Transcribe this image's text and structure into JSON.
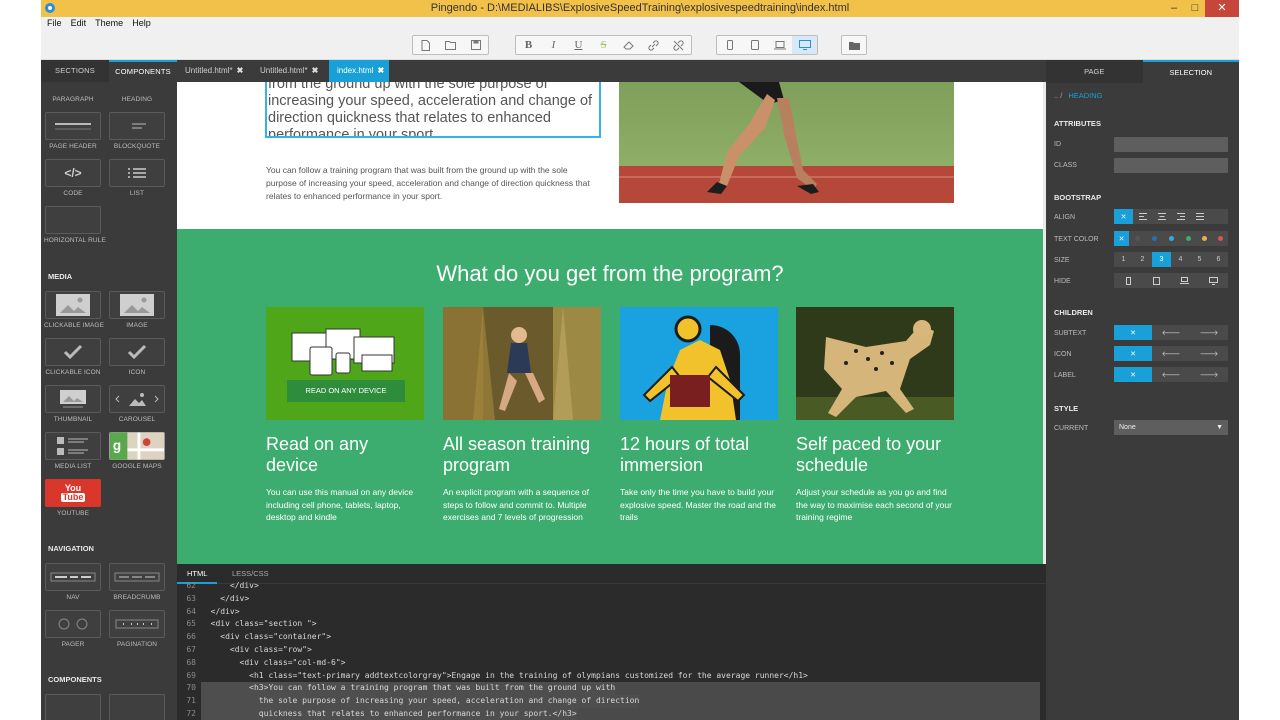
{
  "window": {
    "title": "Pingendo - D:\\MEDIALIBS\\ExplosiveSpeedTraining\\explosivespeedtraining\\index.html",
    "minimize": "–",
    "maximize": "□",
    "close": "✕"
  },
  "menu": [
    "File",
    "Edit",
    "Theme",
    "Help"
  ],
  "toolbar": {
    "file_icons": [
      "new-file-icon",
      "open-folder-icon",
      "save-icon"
    ],
    "format": {
      "bold": "B",
      "italic": "I",
      "underline": "U",
      "strike": "S"
    },
    "format_icons": [
      "eraser-icon",
      "link-icon",
      "unlink-icon"
    ],
    "devices": [
      "phone-icon",
      "tablet-icon",
      "laptop-icon",
      "desktop-icon"
    ],
    "active_device": "desktop-icon",
    "folder_icon": "folder-icon"
  },
  "left_panel": {
    "tabs": [
      "SECTIONS",
      "COMPONENTS"
    ],
    "active_tab": "COMPONENTS",
    "items_top": [
      {
        "label": "PARAGRAPH"
      },
      {
        "label": "HEADING"
      },
      {
        "label": "PAGE HEADER"
      },
      {
        "label": "BLOCKQUOTE"
      },
      {
        "label": "CODE"
      },
      {
        "label": "LIST"
      },
      {
        "label": "HORIZONTAL RULE"
      }
    ],
    "media_heading": "MEDIA",
    "media_items": [
      {
        "label": "CLICKABLE IMAGE"
      },
      {
        "label": "IMAGE"
      },
      {
        "label": "CLICKABLE ICON"
      },
      {
        "label": "ICON"
      },
      {
        "label": "THUMBNAIL"
      },
      {
        "label": "CAROUSEL"
      },
      {
        "label": "MEDIA LIST"
      },
      {
        "label": "GOOGLE MAPS"
      },
      {
        "label": "YOUTUBE",
        "thumb_text_1": "You",
        "thumb_text_2": "Tube"
      }
    ],
    "nav_heading": "NAVIGATION",
    "nav_items": [
      {
        "label": "NAV"
      },
      {
        "label": "BREADCRUMB"
      },
      {
        "label": "PAGER"
      },
      {
        "label": "PAGINATION"
      }
    ],
    "components_heading": "COMPONENTS",
    "code_glyph": "</>"
  },
  "doc_tabs": [
    {
      "label": "Untitled.html*",
      "close": "✖"
    },
    {
      "label": "Untitled.html*",
      "close": "✖"
    },
    {
      "label": "index.html",
      "close": "✖"
    }
  ],
  "active_doc": "index.html",
  "canvas": {
    "hero_heading": "from the ground up with the sole purpose of increasing your speed, acceleration and change of direction quickness that relates to enhanced performance in your sport.",
    "hero_paragraph": "You can follow a training program that was built from the ground up with the sole purpose of increasing your speed, acceleration and change of direction quickness that relates to enhanced performance in your sport.",
    "section_title": "What do you get from the program?",
    "accent_green": "#3dad6f",
    "features": [
      {
        "title": "Read on any device",
        "text": "You can use this manual on any device including cell phone, tablets, laptop, desktop and kindle",
        "button": "READ ON ANY DEVICE"
      },
      {
        "title": "All season training program",
        "text": "An explicit program with a sequence of steps to follow and commit to. Multiple exercises and 7 levels of progression"
      },
      {
        "title": "12 hours of total immersion",
        "text": "Take only the time you have to build your explosive speed. Master the road and the trails"
      },
      {
        "title": "Self paced to your schedule",
        "text": "Adjust your schedule as you go and find the way to maximise each second of your training regime"
      }
    ]
  },
  "code": {
    "tabs": [
      "HTML",
      "LESS/CSS"
    ],
    "active_tab": "HTML",
    "lines": [
      {
        "n": "62",
        "indent": "      ",
        "html": "</div>"
      },
      {
        "n": "63",
        "indent": "    ",
        "html": "</div>"
      },
      {
        "n": "64",
        "indent": "  ",
        "html": "</div>"
      },
      {
        "n": "65",
        "indent": "  ",
        "html": "<div class=\"section \">"
      },
      {
        "n": "66",
        "indent": "    ",
        "html": "<div class=\"container\">"
      },
      {
        "n": "67",
        "indent": "      ",
        "html": "<div class=\"row\">"
      },
      {
        "n": "68",
        "indent": "        ",
        "html": "<div class=\"col-md-6\">"
      },
      {
        "n": "69",
        "indent": "          ",
        "html": "<h1 class=\"text-primary addtextcolorgray\">Engage in the training of olympians customized for the average runner</h1>"
      },
      {
        "n": "70",
        "indent": "          ",
        "html": "<h3>You can follow a training program that was built from the ground up with"
      },
      {
        "n": "71",
        "indent": "            ",
        "html": "the sole purpose of increasing your speed, acceleration and change of direction"
      },
      {
        "n": "72",
        "indent": "            ",
        "html": "quickness that relates to enhanced performance in your sport.</h3>"
      }
    ]
  },
  "right_panel": {
    "tabs": [
      "PAGE",
      "SELECTION"
    ],
    "active_tab": "SELECTION",
    "crumb_root": "..  /",
    "crumb_current": "HEADING",
    "attributes_heading": "ATTRIBUTES",
    "id_label": "ID",
    "class_label": "CLASS",
    "bootstrap_heading": "BOOTSTRAP",
    "align_label": "ALIGN",
    "text_color_label": "TEXT COLOR",
    "size_label": "SIZE",
    "sizes": [
      "1",
      "2",
      "3",
      "4",
      "5",
      "6"
    ],
    "selected_size": "3",
    "hide_label": "HIDE",
    "children_heading": "CHILDREN",
    "children": [
      "SUBTEXT",
      "ICON",
      "LABEL"
    ],
    "style_heading": "STYLE",
    "current_label": "CURRENT",
    "current_value": "None",
    "text_colors": [
      "#555555",
      "#2b6fb3",
      "#39a9dc",
      "#3dad6f",
      "#f0ad4e",
      "#d9534f"
    ],
    "accent_blue": "#1aa0d8"
  }
}
